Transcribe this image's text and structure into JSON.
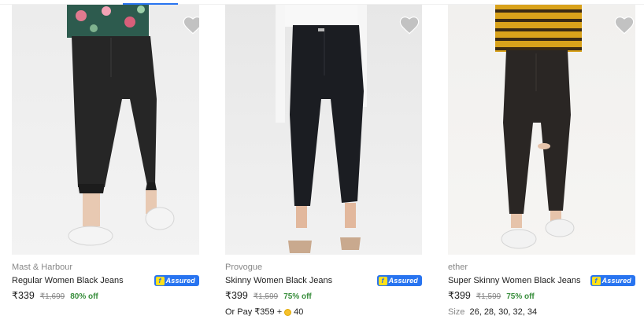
{
  "products": [
    {
      "brand": "Mast & Harbour",
      "title": "Regular Women Black Jeans",
      "assured_label": "Assured",
      "assured_mark": "f",
      "price": "₹339",
      "mrp": "₹1,699",
      "discount": "80% off",
      "icons": {
        "wishlist": "heart-icon",
        "assured": "flipkart-assured-badge"
      }
    },
    {
      "brand": "Provogue",
      "title": "Skinny Women Black Jeans",
      "assured_label": "Assured",
      "assured_mark": "f",
      "price": "₹399",
      "mrp": "₹1,599",
      "discount": "75% off",
      "pay_offer": {
        "prefix": "Or Pay ₹359 +",
        "coins": "40"
      },
      "icons": {
        "wishlist": "heart-icon",
        "assured": "flipkart-assured-badge",
        "coin": "supercoin-icon"
      }
    },
    {
      "brand": "ether",
      "title": "Super Skinny Women Black Jeans",
      "assured_label": "Assured",
      "assured_mark": "f",
      "price": "₹399",
      "mrp": "₹1,599",
      "discount": "75% off",
      "sizes": {
        "label": "Size",
        "values": "26, 28, 30, 32, 34"
      },
      "icons": {
        "wishlist": "heart-icon",
        "assured": "flipkart-assured-badge"
      }
    }
  ],
  "colors": {
    "accent": "#2874f0",
    "discount": "#388e3c",
    "muted": "#878787",
    "assured_yellow": "#ffe11b",
    "heart": "#c2c2c2"
  }
}
